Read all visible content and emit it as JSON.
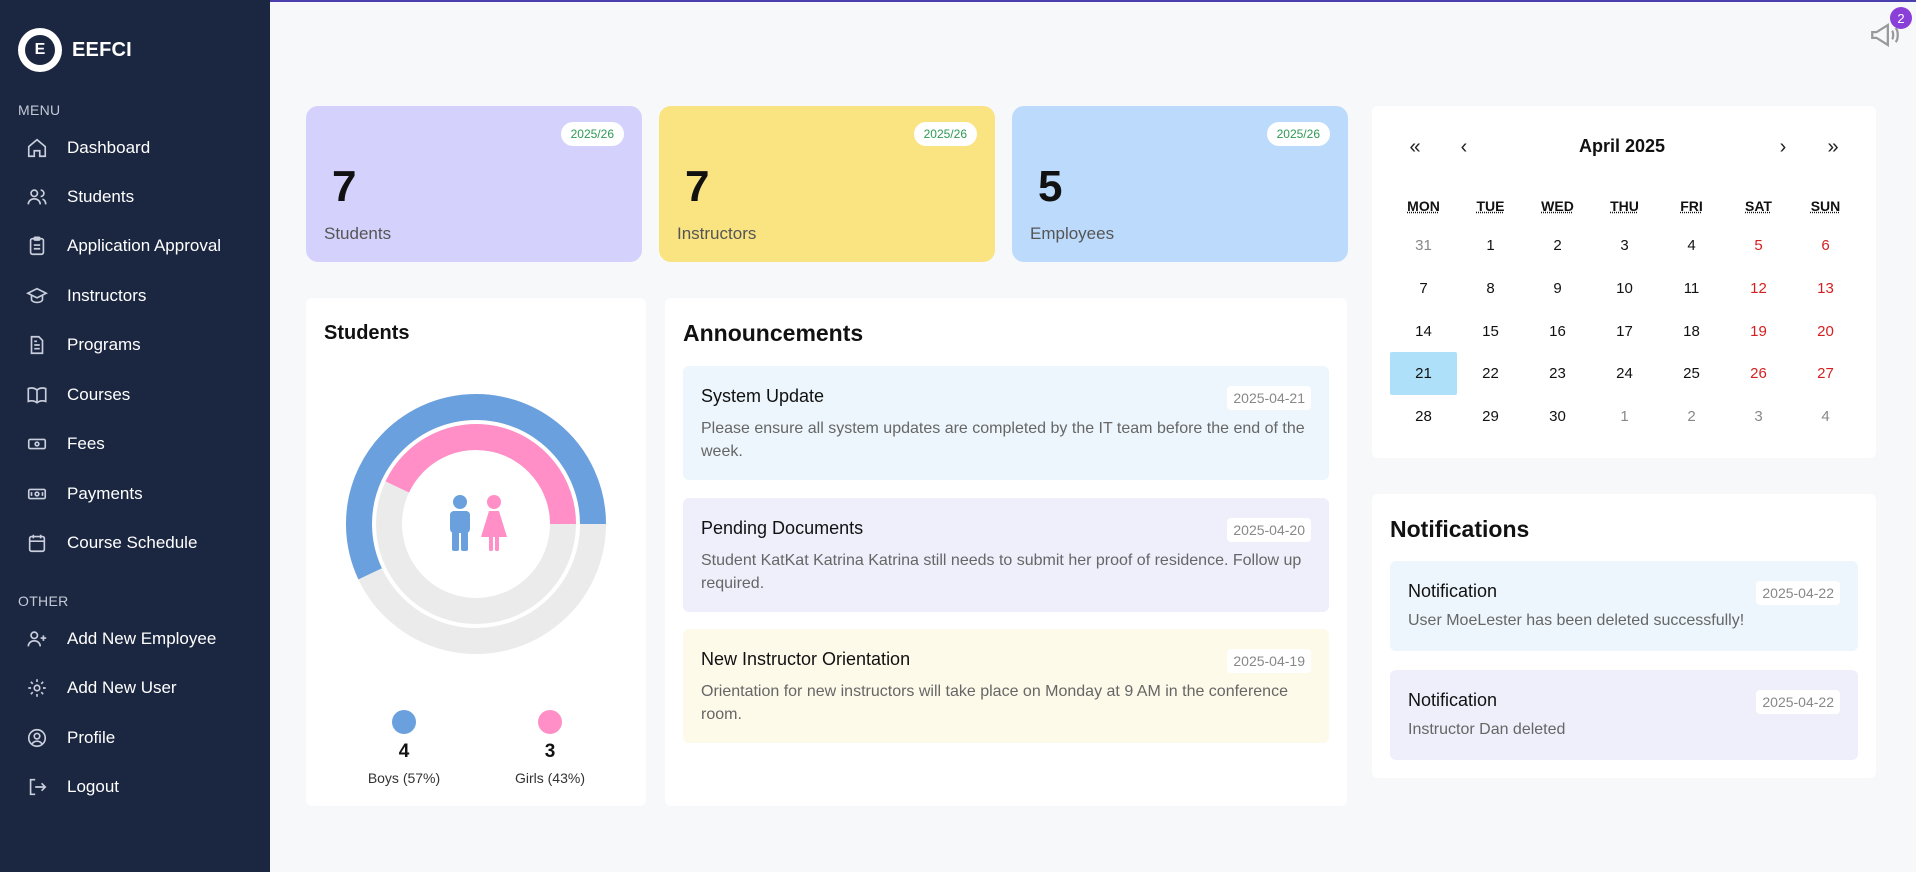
{
  "brand": {
    "name": "EEFCI",
    "logo_letter": "E"
  },
  "sidebar": {
    "menu_label": "MENU",
    "other_label": "OTHER",
    "menu_items": [
      {
        "label": "Dashboard",
        "icon": "home-icon"
      },
      {
        "label": "Students",
        "icon": "users-icon"
      },
      {
        "label": "Application Approval",
        "icon": "clipboard-icon"
      },
      {
        "label": "Instructors",
        "icon": "graduation-cap-icon"
      },
      {
        "label": "Programs",
        "icon": "document-icon"
      },
      {
        "label": "Courses",
        "icon": "book-icon"
      },
      {
        "label": "Fees",
        "icon": "money-icon"
      },
      {
        "label": "Payments",
        "icon": "wallet-icon"
      },
      {
        "label": "Course Schedule",
        "icon": "calendar-icon"
      }
    ],
    "other_items": [
      {
        "label": "Add New Employee",
        "icon": "user-plus-icon"
      },
      {
        "label": "Add New User",
        "icon": "gear-icon"
      },
      {
        "label": "Profile",
        "icon": "user-circle-icon"
      },
      {
        "label": "Logout",
        "icon": "logout-icon"
      }
    ]
  },
  "header": {
    "notification_count": "2"
  },
  "stats": [
    {
      "value": "7",
      "label": "Students",
      "term": "2025/26",
      "color": "#d4d2fc"
    },
    {
      "value": "7",
      "label": "Instructors",
      "term": "2025/26",
      "color": "#f9e481"
    },
    {
      "value": "5",
      "label": "Employees",
      "term": "2025/26",
      "color": "#bcdbfc"
    }
  ],
  "students_panel": {
    "title": "Students",
    "boys": {
      "count": "4",
      "label": "Boys (57%)",
      "percent": 57,
      "color": "#6aa0de"
    },
    "girls": {
      "count": "3",
      "label": "Girls (43%)",
      "percent": 43,
      "color": "#ff8fc6"
    }
  },
  "announcements": {
    "title": "Announcements",
    "items": [
      {
        "title": "System Update",
        "date": "2025-04-21",
        "body": "Please ensure all system updates are completed by the IT team before the end of the week.",
        "bg": "#edf6fc"
      },
      {
        "title": "Pending Documents",
        "date": "2025-04-20",
        "body": "Student KatKat Katrina Katrina still needs to submit her proof of residence. Follow up required.",
        "bg": "#efeffc"
      },
      {
        "title": "New Instructor Orientation",
        "date": "2025-04-19",
        "body": "Orientation for new instructors will take place on Monday at 9 AM in the conference room.",
        "bg": "#fdfaea"
      }
    ]
  },
  "calendar": {
    "month_label": "April 2025",
    "nav": {
      "prev_year": "«",
      "prev_month": "‹",
      "next_month": "›",
      "next_year": "»"
    },
    "weekdays": [
      "MON",
      "TUE",
      "WED",
      "THU",
      "FRI",
      "SAT",
      "SUN"
    ],
    "weeks": [
      [
        "31",
        "1",
        "2",
        "3",
        "4",
        "5",
        "6"
      ],
      [
        "7",
        "8",
        "9",
        "10",
        "11",
        "12",
        "13"
      ],
      [
        "14",
        "15",
        "16",
        "17",
        "18",
        "19",
        "20"
      ],
      [
        "21",
        "22",
        "23",
        "24",
        "25",
        "26",
        "27"
      ],
      [
        "28",
        "29",
        "30",
        "1",
        "2",
        "3",
        "4"
      ]
    ],
    "today": "21"
  },
  "notifications": {
    "title": "Notifications",
    "items": [
      {
        "title": "Notification",
        "date": "2025-04-22",
        "body": "User MoeLester has been deleted successfully!",
        "bg": "#edf6fc"
      },
      {
        "title": "Notification",
        "date": "2025-04-22",
        "body": "Instructor Dan deleted",
        "bg": "#efeffc"
      }
    ]
  }
}
